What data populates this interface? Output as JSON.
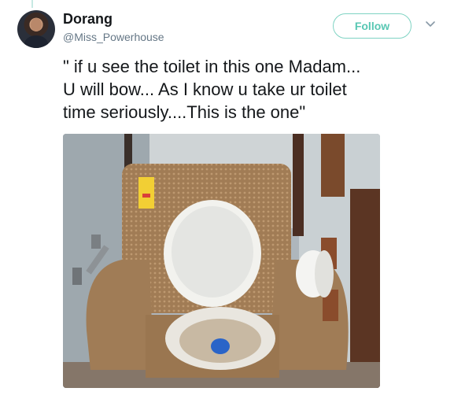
{
  "user": {
    "name": "Dorang",
    "handle": "@Miss_Powerhouse"
  },
  "actions": {
    "follow_label": "Follow"
  },
  "icons": {
    "avatar": "profile-photo",
    "menu": "chevron-down-icon"
  },
  "tweet": {
    "line1": "\" if u see the toilet in this one Madam...",
    "line2": "U will bow... As I know u take ur toilet",
    "line3": "time seriously....This is the one\""
  },
  "colors": {
    "follow_accent": "#58c7b3",
    "text": "#14171a",
    "muted": "#657786"
  }
}
